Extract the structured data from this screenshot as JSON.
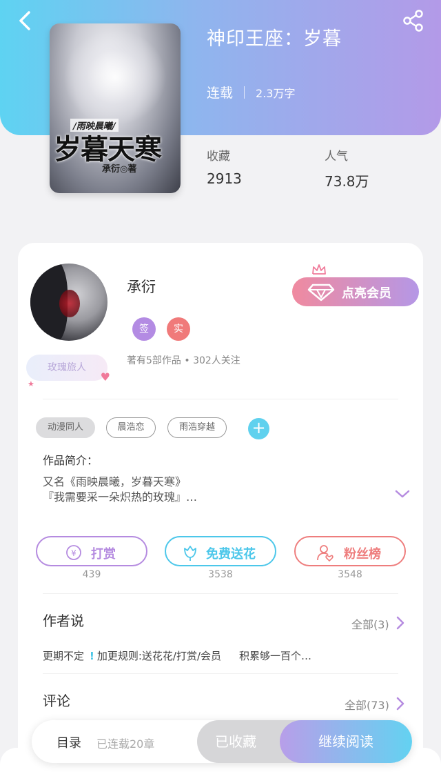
{
  "book": {
    "title": "神印王座：岁暮",
    "status": "连载",
    "word_count": "2.3万字",
    "cover": {
      "subtitle": "/雨映晨曦/",
      "title": "岁暮天寒",
      "author": "承衍◎著"
    },
    "stats": [
      {
        "label": "收藏",
        "value": "2913"
      },
      {
        "label": "人气",
        "value": "73.8万"
      }
    ]
  },
  "author": {
    "name": "承衍",
    "badges": [
      "签",
      "实"
    ],
    "rose_badge": "玫瑰旅人",
    "info": "著有5部作品 • 302人关注",
    "vip_button": "点亮会员"
  },
  "tags": [
    "动漫同人",
    "晨浩恋",
    "雨浩穿越"
  ],
  "intro": {
    "title": "作品简介：",
    "text": "又名《雨映晨曦，岁暮天寒》\n『我需要采一朵炽热的玫瑰』…"
  },
  "actions": [
    {
      "label": "打赏",
      "count": "439",
      "icon": "yen-icon",
      "color": "#b58be0"
    },
    {
      "label": "免费送花",
      "count": "3538",
      "icon": "flower-icon",
      "color": "#4cc7ea"
    },
    {
      "label": "粉丝榜",
      "count": "3548",
      "icon": "fan-icon",
      "color": "#ee7d7d"
    }
  ],
  "author_says": {
    "title": "作者说",
    "all": "全部(3)",
    "notes": [
      "更期不定",
      "加更规则:送花花/打赏/会员",
      "积累够一百个…"
    ]
  },
  "comments": {
    "title": "评论",
    "all": "全部(73)"
  },
  "bottom": {
    "catalog": "目录",
    "chapters": "已连载20章",
    "collected": "已收藏",
    "continue": "继续阅读"
  },
  "colors": {
    "header_start": "#5ed3f2",
    "header_end": "#b39ae8",
    "accent_purple": "#b58be0",
    "accent_cyan": "#4cc7ea",
    "accent_red": "#ee7d7d"
  }
}
